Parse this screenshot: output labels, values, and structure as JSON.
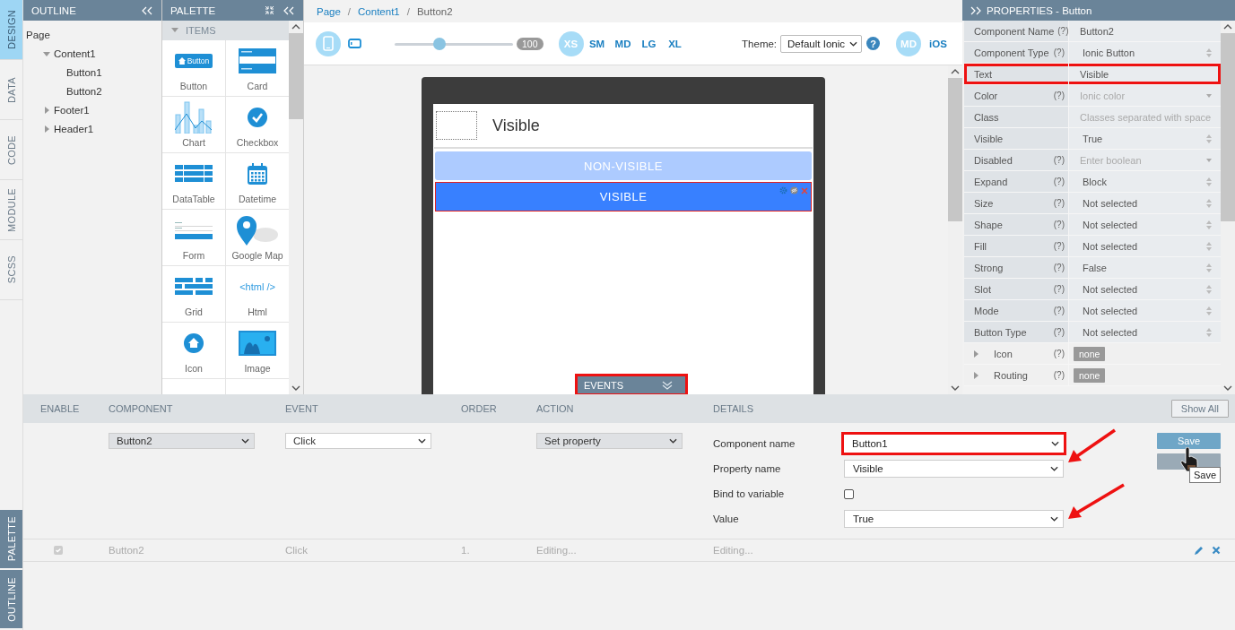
{
  "side_tabs": [
    {
      "label": "DESIGN",
      "selected": true
    },
    {
      "label": "DATA",
      "selected": false
    },
    {
      "label": "CODE",
      "selected": false
    },
    {
      "label": "MODULE",
      "selected": false
    },
    {
      "label": "SCSS",
      "selected": false
    }
  ],
  "dock_tabs": [
    {
      "label": "PALETTE"
    },
    {
      "label": "OUTLINE"
    }
  ],
  "outline": {
    "title": "OUTLINE",
    "tree": [
      {
        "label": "Page",
        "children": [
          {
            "label": "Content1",
            "expanded": true,
            "children": [
              {
                "label": "Button1"
              },
              {
                "label": "Button2"
              }
            ]
          },
          {
            "label": "Footer1",
            "expanded": false
          },
          {
            "label": "Header1",
            "expanded": false
          }
        ]
      }
    ]
  },
  "palette": {
    "title": "PALETTE",
    "section": "ITEMS",
    "icon_texts": {
      "button": "Button",
      "html": "<html />"
    },
    "items": [
      {
        "label": "Button",
        "kind": "button"
      },
      {
        "label": "Card",
        "kind": "card"
      },
      {
        "label": "Chart",
        "kind": "chart"
      },
      {
        "label": "Checkbox",
        "kind": "checkbox"
      },
      {
        "label": "DataTable",
        "kind": "datatable"
      },
      {
        "label": "Datetime",
        "kind": "datetime"
      },
      {
        "label": "Form",
        "kind": "form"
      },
      {
        "label": "Google Map",
        "kind": "map"
      },
      {
        "label": "Grid",
        "kind": "grid"
      },
      {
        "label": "Html",
        "kind": "html"
      },
      {
        "label": "Icon",
        "kind": "icon"
      },
      {
        "label": "Image",
        "kind": "image"
      }
    ]
  },
  "breadcrumb": {
    "separator": "/",
    "items": [
      "Page",
      "Content1",
      "Button2"
    ]
  },
  "toolbar": {
    "devices": [
      {
        "kind": "phone",
        "selected": true
      },
      {
        "kind": "tablet",
        "selected": false
      }
    ],
    "zoom": {
      "level": 0.38,
      "reading": "100"
    },
    "sizes": [
      {
        "label": "XS",
        "selected": true
      },
      {
        "label": "SM",
        "selected": false
      },
      {
        "label": "MD",
        "selected": false
      },
      {
        "label": "LG",
        "selected": false
      },
      {
        "label": "XL",
        "selected": false
      }
    ],
    "theme_label": "Theme:",
    "theme": "Default Ionic",
    "help": "?",
    "modes": [
      {
        "label": "MD",
        "selected": true
      },
      {
        "label": "iOS",
        "selected": false
      }
    ]
  },
  "device": {
    "header_title": "Visible",
    "buttons": [
      {
        "label": "NON-VISIBLE",
        "visible": false,
        "selected": false
      },
      {
        "label": "VISIBLE",
        "visible": true,
        "selected": true
      }
    ]
  },
  "events_tab": {
    "label": "EVENTS",
    "highlighted": true
  },
  "properties": {
    "title": "PROPERTIES - Button",
    "rows": [
      {
        "label": "Component Name",
        "help": "(?)",
        "value": "Button2",
        "kind": "text",
        "highlighted": false
      },
      {
        "label": "Component Type",
        "help": "(?)",
        "value": "Ionic Button",
        "kind": "select",
        "highlighted": false
      },
      {
        "label": "Text",
        "value": "Visible",
        "kind": "text",
        "highlighted": true
      },
      {
        "label": "Color",
        "help": "(?)",
        "placeholder": "Ionic color",
        "kind": "placeholder-select",
        "highlighted": false
      },
      {
        "label": "Class",
        "placeholder": "Classes separated with space",
        "kind": "placeholder",
        "highlighted": false
      },
      {
        "label": "Visible",
        "value": "True",
        "kind": "select",
        "highlighted": false
      },
      {
        "label": "Disabled",
        "help": "(?)",
        "placeholder": "Enter boolean",
        "kind": "placeholder-select",
        "highlighted": false
      },
      {
        "label": "Expand",
        "help": "(?)",
        "value": "Block",
        "kind": "select",
        "highlighted": false
      },
      {
        "label": "Size",
        "help": "(?)",
        "value": "Not selected",
        "kind": "select",
        "highlighted": false
      },
      {
        "label": "Shape",
        "help": "(?)",
        "value": "Not selected",
        "kind": "select",
        "highlighted": false
      },
      {
        "label": "Fill",
        "help": "(?)",
        "value": "Not selected",
        "kind": "select",
        "highlighted": false
      },
      {
        "label": "Strong",
        "help": "(?)",
        "value": "False",
        "kind": "select",
        "highlighted": false
      },
      {
        "label": "Slot",
        "help": "(?)",
        "value": "Not selected",
        "kind": "select",
        "highlighted": false
      },
      {
        "label": "Mode",
        "help": "(?)",
        "value": "Not selected",
        "kind": "select",
        "highlighted": false
      },
      {
        "label": "Button Type",
        "help": "(?)",
        "value": "Not selected",
        "kind": "select",
        "highlighted": false
      },
      {
        "label": "Icon",
        "help": "(?)",
        "value": "none",
        "kind": "badge",
        "expanded": false,
        "highlighted": false
      },
      {
        "label": "Routing",
        "help": "(?)",
        "value": "none",
        "kind": "badge",
        "expanded": false,
        "highlighted": false
      }
    ]
  },
  "events": {
    "columns": [
      "ENABLE",
      "COMPONENT",
      "EVENT",
      "ORDER",
      "ACTION",
      "DETAILS"
    ],
    "show_all": "Show All",
    "editor": {
      "component": "Button2",
      "event": "Click",
      "action": "Set property",
      "details": [
        {
          "label": "Component name",
          "kind": "select",
          "value": "Button1",
          "highlighted": true
        },
        {
          "label": "Property name",
          "kind": "select",
          "value": "Visible",
          "highlighted": false
        },
        {
          "label": "Bind to variable",
          "kind": "checkbox",
          "checked": false
        },
        {
          "label": "Value",
          "kind": "select",
          "value": "True",
          "highlighted": false
        }
      ],
      "save": "Save",
      "tooltip": "Save"
    },
    "rows": [
      {
        "enabled": true,
        "component": "Button2",
        "event": "Click",
        "order": "1.",
        "action": "Editing...",
        "details": "Editing..."
      }
    ]
  }
}
